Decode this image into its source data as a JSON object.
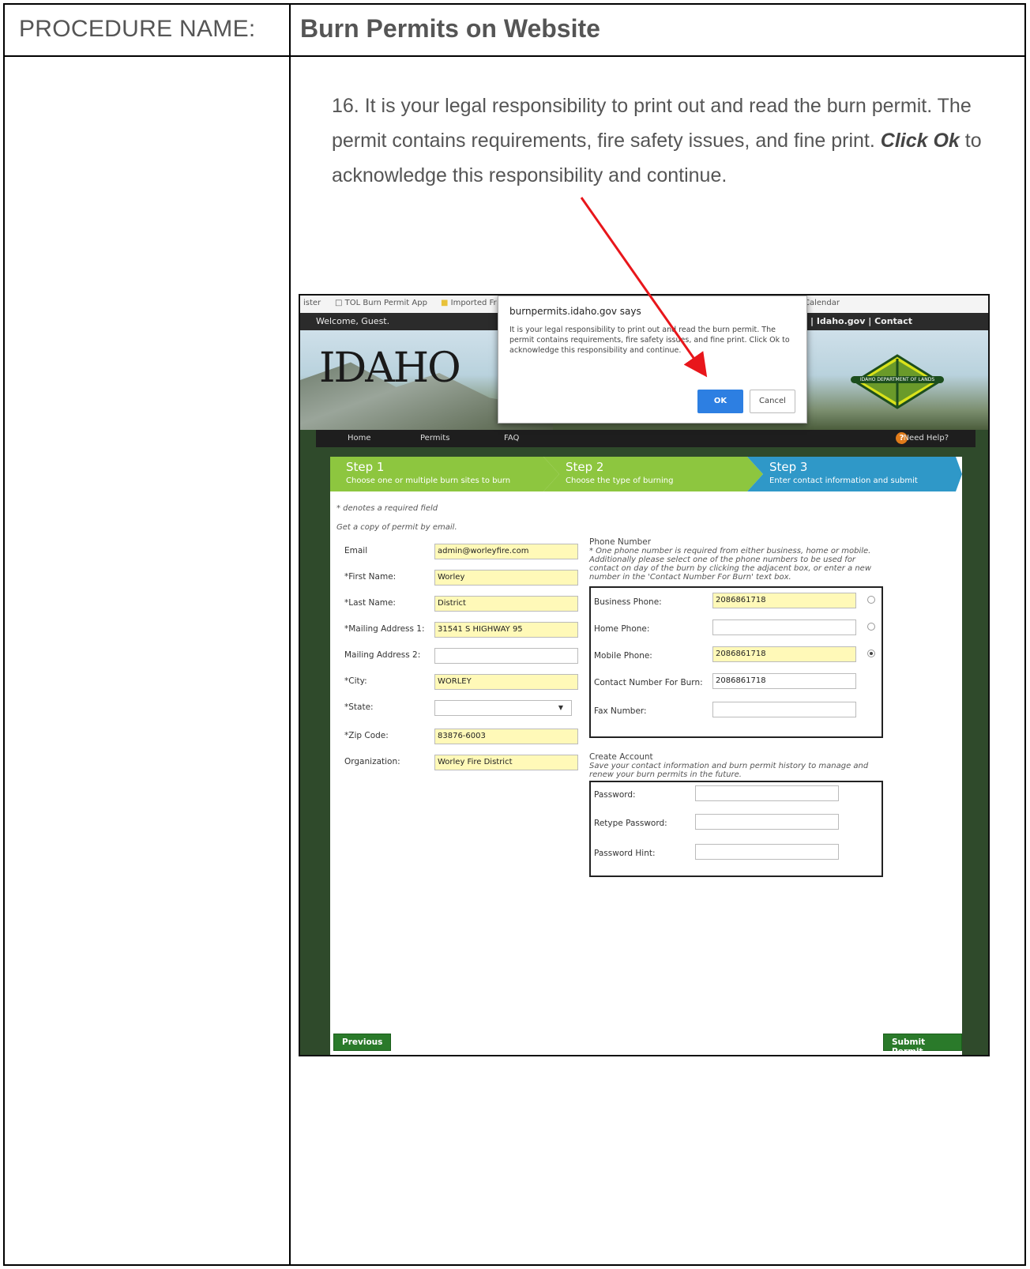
{
  "procedure": {
    "label": "PROCEDURE NAME:",
    "name": "Burn Permits on Website"
  },
  "instruction": {
    "number": "16.",
    "text_before": "It is your legal responsibility to print out and read the burn permit. The permit contains requirements, fire safety issues, and fine print. ",
    "emphasis": "Click Ok",
    "text_after": " to acknowledge this responsibility and continue."
  },
  "colors": {
    "arrow": "#e8161b",
    "step_green": "#8dc63f",
    "step_blue": "#2f98c8",
    "required_field": "#fff9b8",
    "ok_button": "#2d7fe2"
  },
  "screenshot": {
    "bookmarks": {
      "item1": "ister",
      "item2": "TOL Burn Permit App",
      "item3": "Imported Fr",
      "item4": "Calendar"
    },
    "top_bar": {
      "welcome": "Welcome, Guest.",
      "links": "og In  |  Idaho.gov  |  Contact"
    },
    "header": {
      "logo": "IDAHO",
      "idl_logo": "IDAHO DEPARTMENT OF LANDS"
    },
    "nav": {
      "home": "Home",
      "permits": "Permits",
      "faq": "FAQ",
      "help": "Need Help?"
    },
    "dialog": {
      "title": "burnpermits.idaho.gov says",
      "message": "It is your legal responsibility to print out and read the burn permit. The permit contains requirements, fire safety issues, and fine print. Click Ok to acknowledge this responsibility and continue.",
      "ok": "OK",
      "cancel": "Cancel"
    },
    "steps": [
      {
        "title": "Step 1",
        "subtitle": "Choose one or multiple burn sites to burn"
      },
      {
        "title": "Step 2",
        "subtitle": "Choose the type of burning"
      },
      {
        "title": "Step 3",
        "subtitle": "Enter contact information and submit"
      }
    ],
    "form": {
      "required_note": "* denotes a required field",
      "email_note": "Get a copy of permit by email.",
      "fields": {
        "email": {
          "label": "Email",
          "value": "admin@worleyfire.com"
        },
        "first_name": {
          "label": "*First Name:",
          "value": "Worley"
        },
        "last_name": {
          "label": "*Last Name:",
          "value": "District"
        },
        "mailing1": {
          "label": "*Mailing Address 1:",
          "value": "31541 S HIGHWAY 95"
        },
        "mailing2": {
          "label": "Mailing Address 2:",
          "value": ""
        },
        "city": {
          "label": "*City:",
          "value": "WORLEY"
        },
        "state": {
          "label": "*State:",
          "value": ""
        },
        "zip": {
          "label": "*Zip Code:",
          "value": "83876-6003"
        },
        "organization": {
          "label": "Organization:",
          "value": "Worley Fire District"
        }
      },
      "phone": {
        "title": "Phone Number",
        "note": "* One phone number is required from either business, home or mobile. Additionally please select one of the phone numbers to be used for contact on day of the burn by clicking the adjacent box, or enter a new number in the 'Contact Number For Burn' text box.",
        "business": {
          "label": "Business Phone:",
          "value": "2086861718"
        },
        "home": {
          "label": "Home Phone:",
          "value": ""
        },
        "mobile": {
          "label": "Mobile Phone:",
          "value": "2086861718"
        },
        "contact": {
          "label": "Contact Number For Burn:",
          "value": "2086861718"
        },
        "fax": {
          "label": "Fax Number:",
          "value": ""
        }
      },
      "account": {
        "title": "Create Account",
        "note": "Save your contact information and burn permit history to manage and renew your burn permits in the future.",
        "password": "Password:",
        "retype": "Retype Password:",
        "hint": "Password Hint:"
      },
      "buttons": {
        "previous": "Previous",
        "submit": "Submit Permit"
      }
    }
  }
}
